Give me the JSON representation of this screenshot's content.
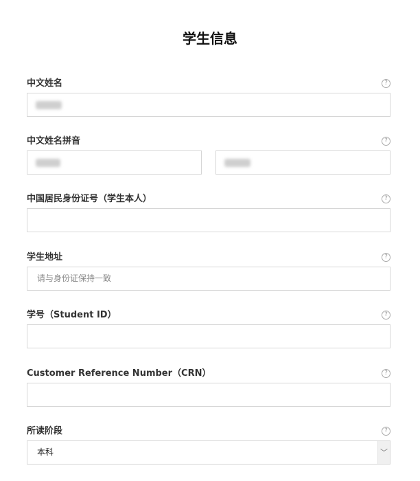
{
  "form": {
    "title": "学生信息",
    "fields": [
      {
        "label": "中文姓名",
        "help_icon": "?"
      },
      {
        "label": "中文姓名拼音",
        "help_icon": "?"
      },
      {
        "label": "中国居民身份证号（学生本人）",
        "help_icon": "?"
      },
      {
        "label": "学生地址",
        "help_icon": "?",
        "placeholder": "请与身份证保持一致"
      },
      {
        "label": "学号（Student ID）",
        "help_icon": "?"
      },
      {
        "label": "Customer Reference Number（CRN）",
        "help_icon": "?"
      },
      {
        "label": "所读阶段",
        "help_icon": "?",
        "selected": "本科",
        "arrow": "﹀"
      }
    ]
  }
}
